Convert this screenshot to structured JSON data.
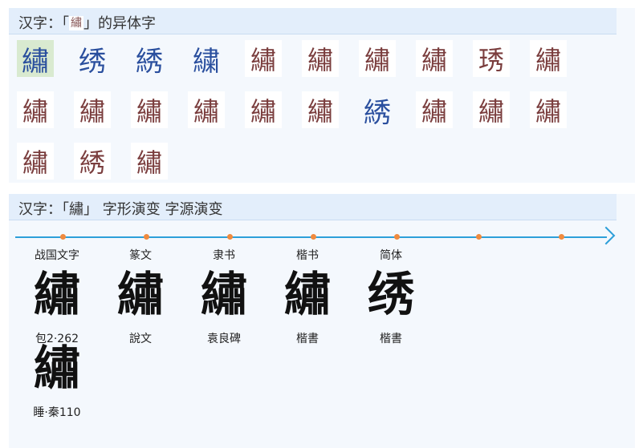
{
  "panel1": {
    "title": "汉字：「",
    "title_glyph": "繡",
    "title_suffix": "」的异体字",
    "variants": [
      {
        "char": "繡",
        "style": "std",
        "selected": true
      },
      {
        "char": "绣",
        "style": "std"
      },
      {
        "char": "綉",
        "style": "std"
      },
      {
        "char": "繍",
        "style": "std"
      },
      {
        "char": "繡",
        "style": "img"
      },
      {
        "char": "繡",
        "style": "img"
      },
      {
        "char": "繡",
        "style": "img"
      },
      {
        "char": "繡",
        "style": "img"
      },
      {
        "char": "琇",
        "style": "img"
      },
      {
        "char": "繡",
        "style": "img"
      },
      {
        "char": "繡",
        "style": "img"
      },
      {
        "char": "繡",
        "style": "img"
      },
      {
        "char": "繡",
        "style": "img"
      },
      {
        "char": "繡",
        "style": "img"
      },
      {
        "char": "繡",
        "style": "img"
      },
      {
        "char": "繡",
        "style": "img"
      },
      {
        "char": "綉",
        "style": "std"
      },
      {
        "char": "繡",
        "style": "img"
      },
      {
        "char": "繡",
        "style": "img"
      },
      {
        "char": "繡",
        "style": "img"
      },
      {
        "char": "繡",
        "style": "img"
      },
      {
        "char": "綉",
        "style": "img"
      },
      {
        "char": "繡",
        "style": "img"
      }
    ]
  },
  "panel2": {
    "title": "汉字：「繡」 字形演变 字源演变",
    "evolution": [
      {
        "era": "战国文字",
        "glyph": "繡",
        "source": "包2·262"
      },
      {
        "era": "篆文",
        "glyph": "繡",
        "source": "說文"
      },
      {
        "era": "隶书",
        "glyph": "繡",
        "source": "袁良碑"
      },
      {
        "era": "楷书",
        "glyph": "繡",
        "source": "楷書"
      },
      {
        "era": "简体",
        "glyph": "绣",
        "source": "楷書"
      },
      {
        "era": "",
        "glyph": "繡",
        "source": "睡·秦110"
      }
    ]
  },
  "colors": {
    "accent": "#2d9fd9",
    "dot": "#f08a3e",
    "variant_std": "#2a4f9e",
    "variant_img": "#7a3d3d",
    "header_bg": "#e3eefb"
  }
}
